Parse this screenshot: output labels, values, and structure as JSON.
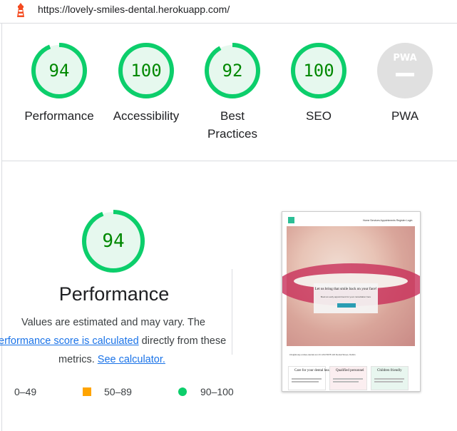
{
  "browser": {
    "url": "https://lovely-smiles-dental.herokuapp.com/",
    "icon": "lighthouse-icon"
  },
  "categories": [
    {
      "label": "Performance",
      "score": 94,
      "lines": [
        "Performance"
      ]
    },
    {
      "label": "Accessibility",
      "score": 100,
      "lines": [
        "Accessibility"
      ]
    },
    {
      "label": "Best Practices",
      "score": 92,
      "lines": [
        "Best",
        "Practices"
      ]
    },
    {
      "label": "SEO",
      "score": 100,
      "lines": [
        "SEO"
      ]
    },
    {
      "label": "PWA",
      "score": null,
      "badge_text": "PWA",
      "lines": [
        "PWA"
      ]
    }
  ],
  "detail": {
    "score": "94",
    "score_value": 94,
    "title": "Performance",
    "desc_part1": "Values are estimated and may vary. The",
    "desc_link1": "erformance score is calculated",
    "desc_part2": " directly from these",
    "desc_part3": "metrics. ",
    "desc_link2": "See calculator."
  },
  "legend": {
    "fail": "0–49",
    "average": "50–89",
    "pass": "90–100"
  },
  "colors": {
    "pass": "#0cce6b",
    "pass_bg": "#e6f8ee",
    "pass_text": "#008800",
    "average": "#ffa400",
    "na_bg": "#e0e0e0",
    "link": "#1a73e8"
  },
  "thumbnail": {
    "nav_links": "Home  Services  Appointments  Register  Login",
    "hero_title": "Let us bring that smile back on your face!",
    "hero_sub": "Book an early appointment for your consultation here",
    "contact": "info@lovely-smiles-dental.com     01 234 5678     123 Dental Street, Dublin",
    "cards": [
      "Care for your dental health",
      "Qualified personnel",
      "Children friendly"
    ]
  }
}
